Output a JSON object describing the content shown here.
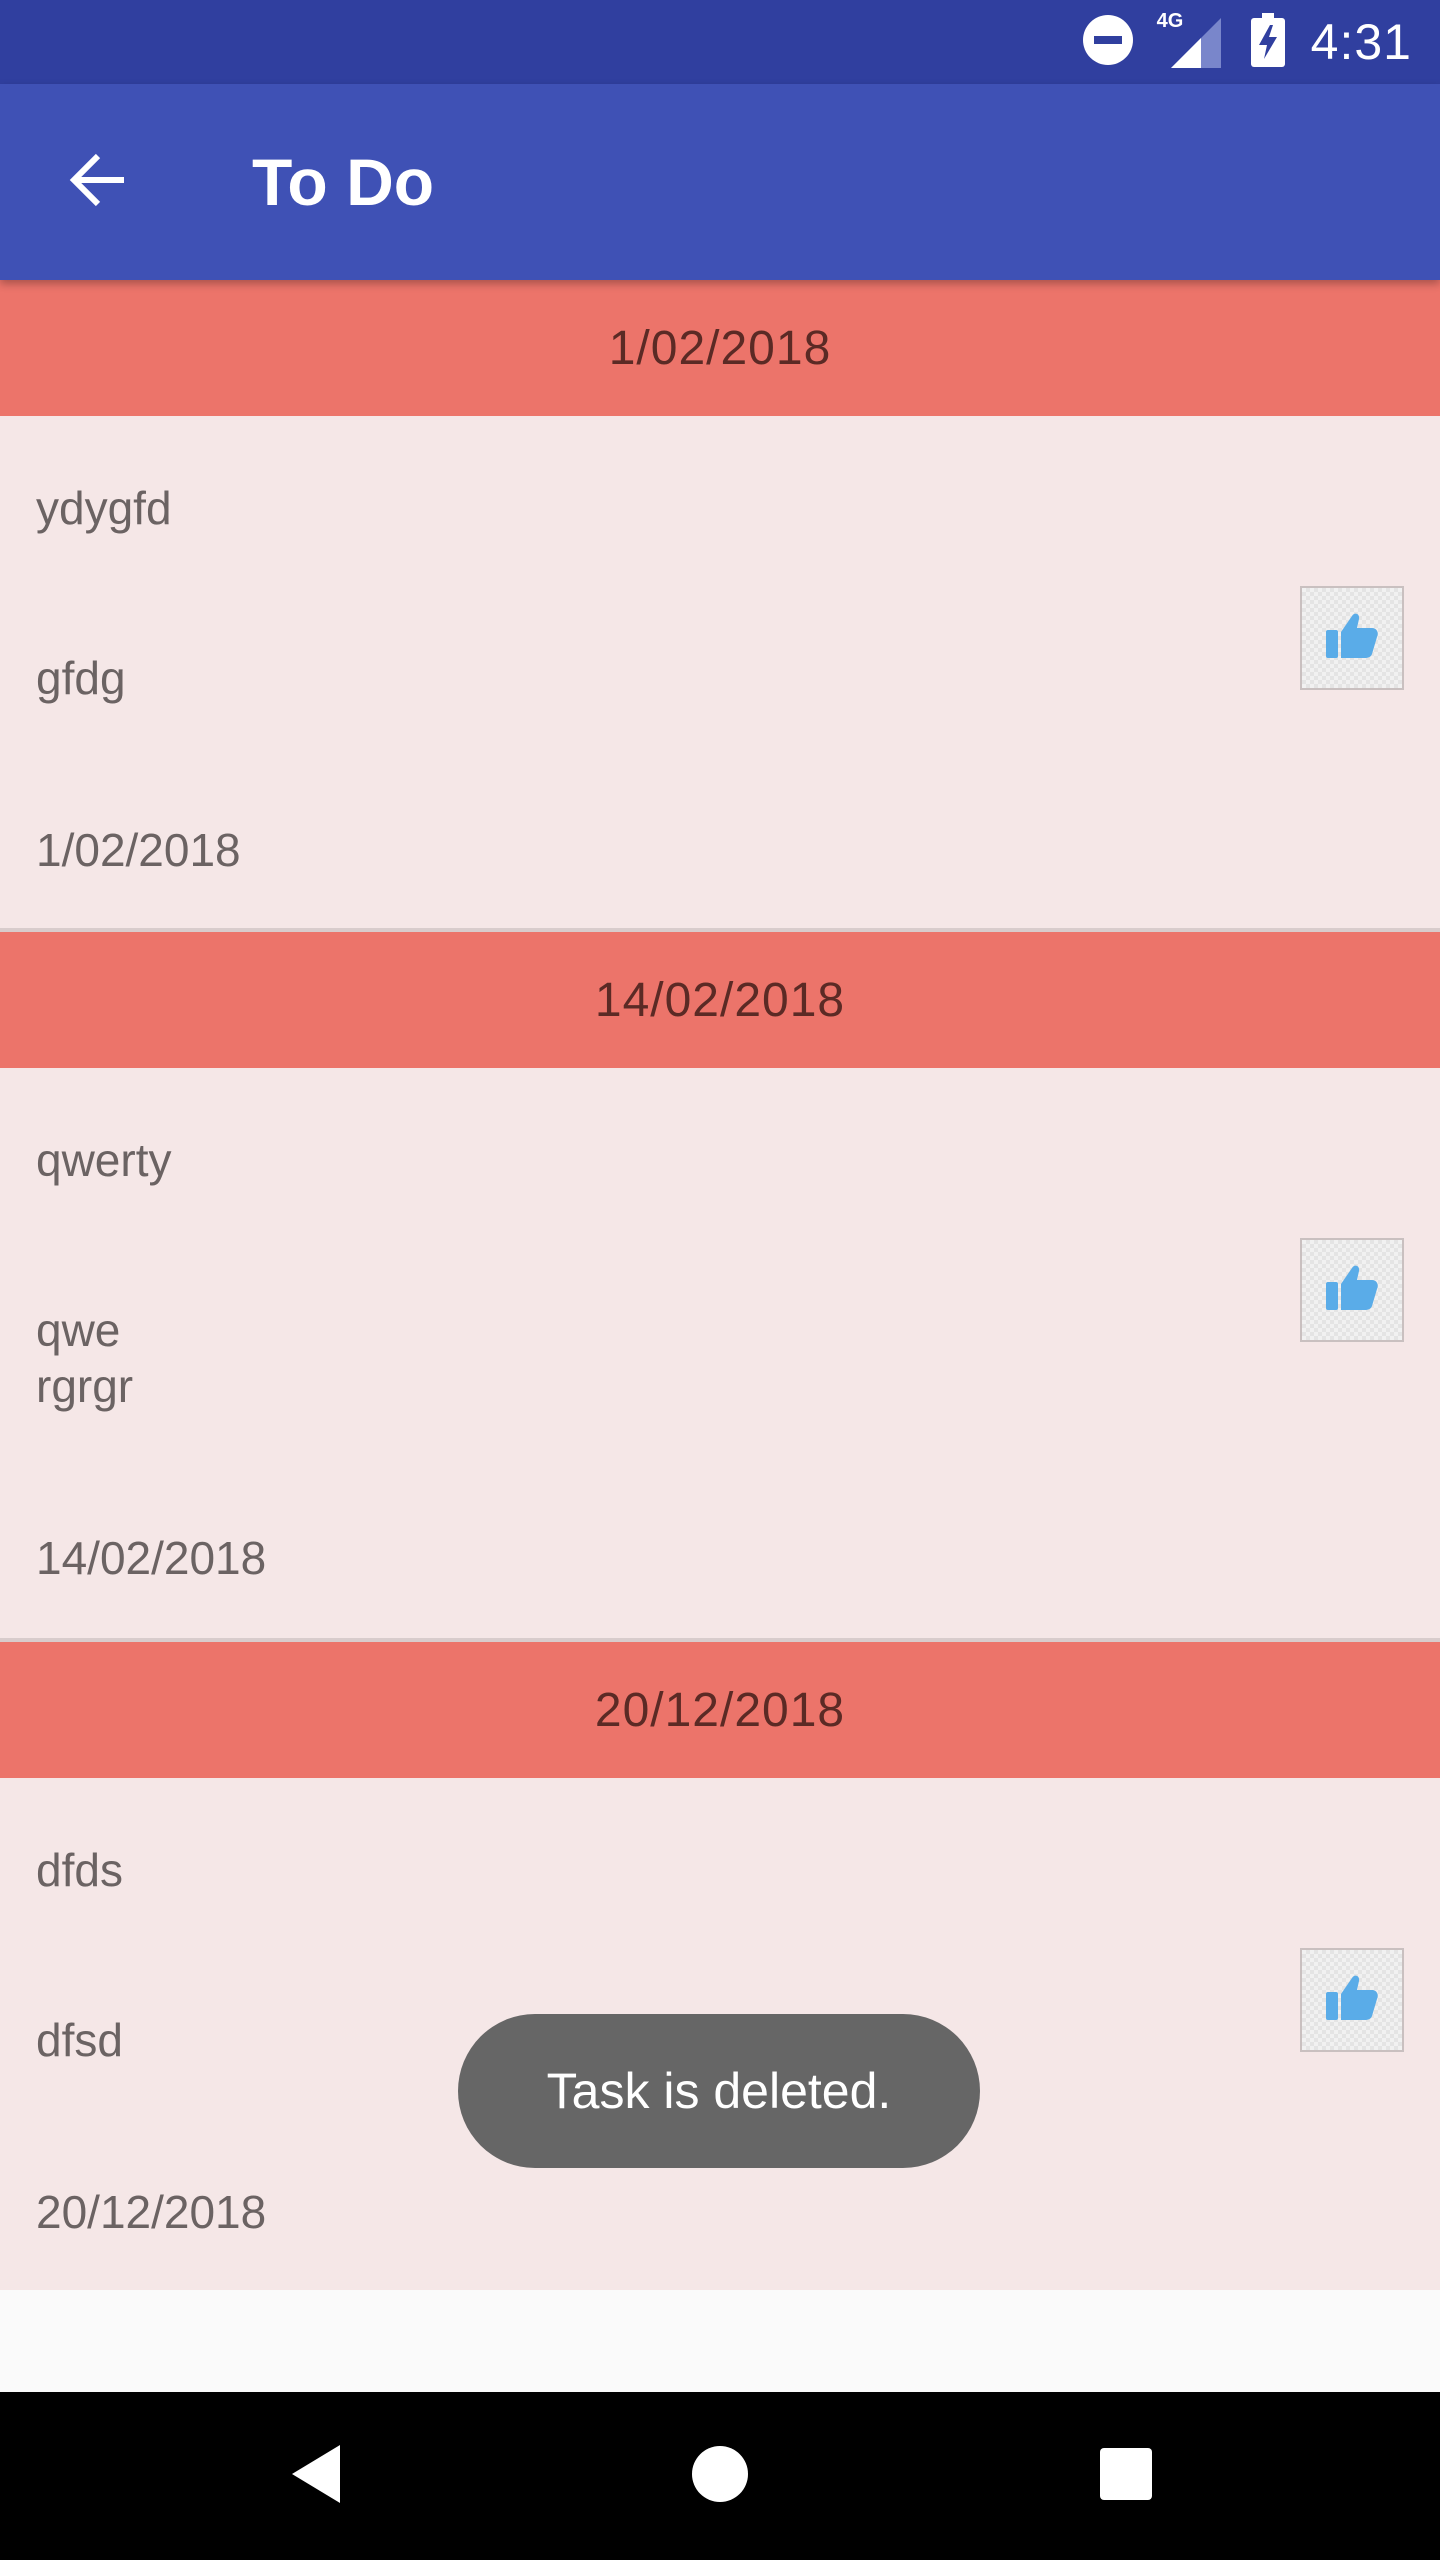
{
  "status_bar": {
    "time": "4:31",
    "network": "4G",
    "icons": [
      "do-not-disturb-icon",
      "signal-icon",
      "battery-charging-icon"
    ]
  },
  "app_bar": {
    "title": "To Do",
    "back_icon": "arrow-back-icon"
  },
  "tasks": [
    {
      "header_date": "1/02/2018",
      "title": "ydygfd",
      "description": "gfdg",
      "date": "1/02/2018"
    },
    {
      "header_date": "14/02/2018",
      "title": "qwerty",
      "description_lines": [
        "qwe",
        "rgrgr"
      ],
      "date": "14/02/2018"
    },
    {
      "header_date": "20/12/2018",
      "title": "dfds",
      "description": "dfsd",
      "date": "20/12/2018"
    }
  ],
  "toast": {
    "message": "Task is deleted."
  },
  "colors": {
    "status_bar": "#303F9F",
    "app_bar": "#3F51B5",
    "date_header": "#EC746A",
    "card_background": "#F5E7E7",
    "like_icon": "#5AACE8",
    "toast": "#666666"
  },
  "nav_bar": {
    "icons": [
      "back-triangle-icon",
      "home-circle-icon",
      "recents-square-icon"
    ]
  }
}
